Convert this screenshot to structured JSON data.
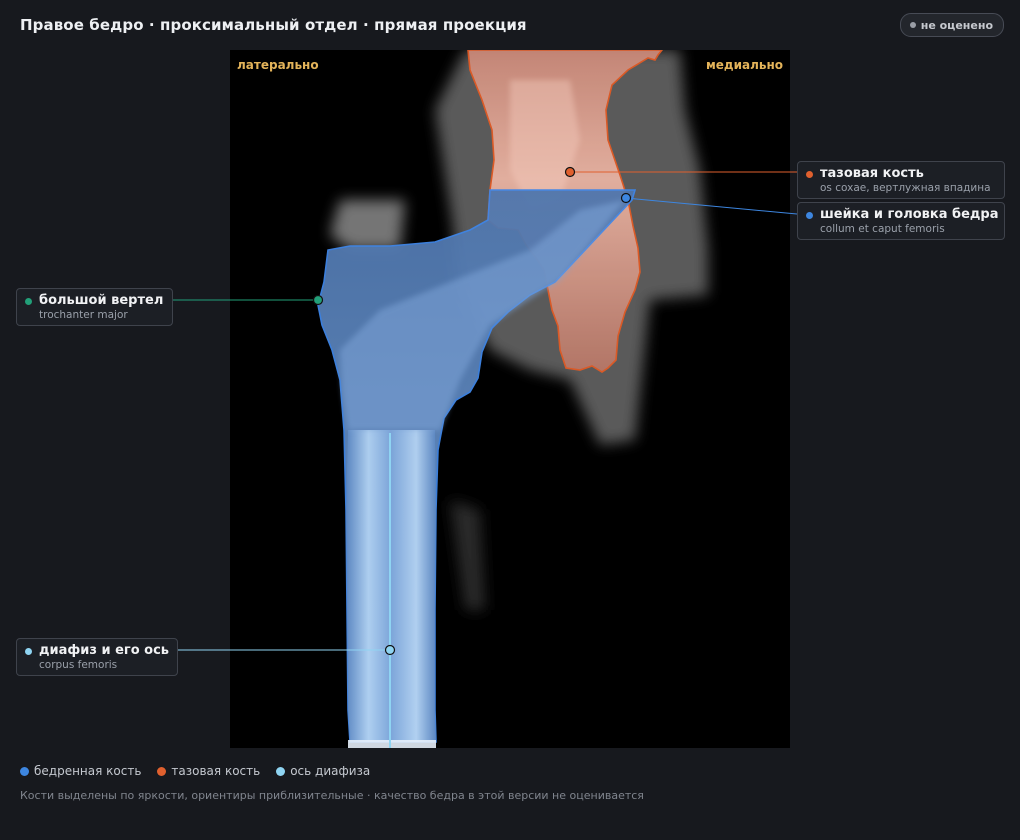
{
  "header": {
    "title": "Правое бедро · проксимальный отдел · прямая проекция",
    "status_badge": "не оценено"
  },
  "image": {
    "orientation_left": "латерально",
    "orientation_right": "медиально"
  },
  "labels": {
    "pelvis": {
      "name": "тазовая кость",
      "latin": "os coxae, вертлужная впадина",
      "color": "#e0602e"
    },
    "neck": {
      "name": "шейка и головка бедра",
      "latin": "collum et caput femoris",
      "color": "#3d86e0"
    },
    "trochanter": {
      "name": "большой вертел",
      "latin": "trochanter major",
      "color": "#22a079"
    },
    "shaft": {
      "name": "диафиз и его ось",
      "latin": "corpus femoris",
      "color": "#8fd4f2"
    }
  },
  "legend": {
    "femur": {
      "label": "бедренная кость",
      "color": "#3d86e0"
    },
    "pelvis": {
      "label": "тазовая кость",
      "color": "#e0602e"
    },
    "axis": {
      "label": "ось диафиза",
      "color": "#8fd4f2"
    }
  },
  "footer": {
    "note": "Кости выделены по яркости, ориентиры приблизительные · качество бедра в этой версии не оценивается"
  }
}
